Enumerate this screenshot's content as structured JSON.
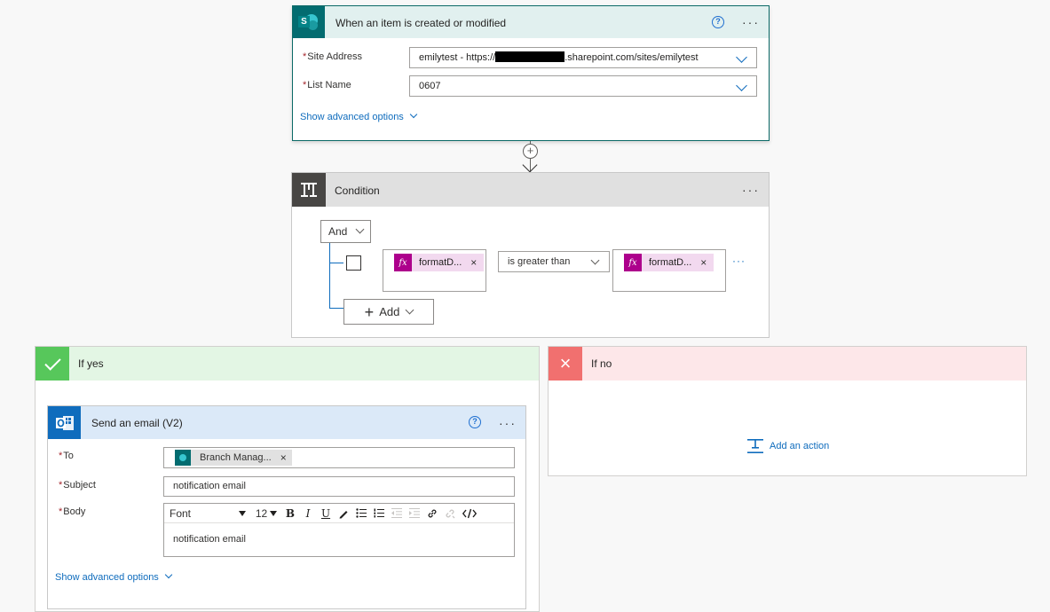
{
  "trigger": {
    "title": "When an item is created or modified",
    "help_icon": "question-circle-icon",
    "site_address_label": "Site Address",
    "site_address_prefix": "emilytest - https://",
    "site_address_suffix": ".sharepoint.com/sites/emilytest",
    "list_name_label": "List Name",
    "list_name_value": "0607",
    "advanced_link": "Show advanced options",
    "more": "···"
  },
  "connector": {
    "add_symbol": "+"
  },
  "condition": {
    "title": "Condition",
    "more": "···",
    "group_operator": "And",
    "left_operand_token": "formatD...",
    "operator": "is greater than",
    "right_operand_token": "formatD...",
    "fx_label": "fx",
    "remove_symbol": "×",
    "row_more": "···",
    "add_label": "Add",
    "add_symbol": "+"
  },
  "if_yes": {
    "title": "If yes"
  },
  "if_no": {
    "title": "If no",
    "close_symbol": "×",
    "add_action": "Add an action"
  },
  "email": {
    "title": "Send an email (V2)",
    "more": "···",
    "to_label": "To",
    "to_token": "Branch Manag...",
    "remove_symbol": "×",
    "subject_label": "Subject",
    "subject_value": "notification email",
    "body_label": "Body",
    "font_label": "Font",
    "font_size": "12",
    "body_value": "notification email",
    "advanced_link": "Show advanced options",
    "required_marker": "*"
  },
  "colors": {
    "trigger_accent": "#036c70",
    "condition_accent": "#484644",
    "yes_accent": "#57c75b",
    "no_accent": "#f1706f",
    "email_accent": "#0f6cbd",
    "link": "#0f6cbd"
  }
}
